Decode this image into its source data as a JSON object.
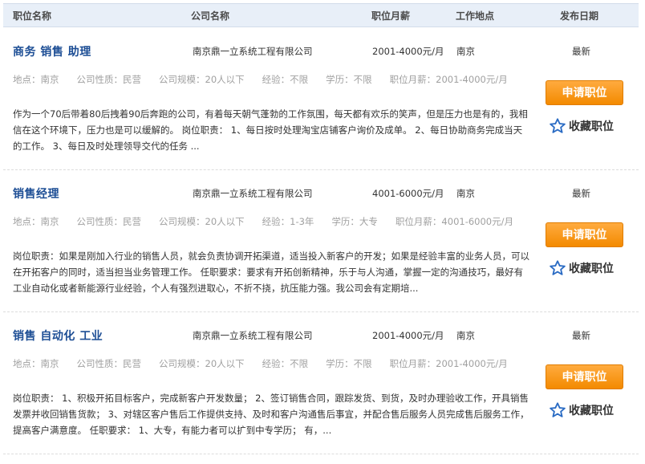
{
  "header": {
    "title": "职位名称",
    "company": "公司名称",
    "salary": "职位月薪",
    "location": "工作地点",
    "date": "发布日期"
  },
  "actions": {
    "apply_label": "申请职位",
    "favorite_label": "收藏职位"
  },
  "jobs": [
    {
      "title": "商务 销售 助理",
      "company": "南京鼎一立系统工程有限公司",
      "salary": "2001-4000元/月",
      "location": "南京",
      "date": "最新",
      "meta": {
        "place": "地点：南京",
        "nature": "公司性质：民营",
        "scale": "公司规模：20人以下",
        "experience": "经验：不限",
        "education": "学历：不限",
        "salary": "职位月薪：2001-4000元/月"
      },
      "description": "作为一个70后带着80后拽着90后奔跑的公司，有着每天朝气蓬勃的工作氛围，每天都有欢乐的笑声，但是压力也是有的，我相信在这个环境下，压力也是可以缓解的。 岗位职责： 1、每日按时处理淘宝店铺客户询价及成单。 2、每日协助商务完成当天的工作。 3、每日及时处理领导交代的任务 ..."
    },
    {
      "title": "销售经理",
      "company": "南京鼎一立系统工程有限公司",
      "salary": "4001-6000元/月",
      "location": "南京",
      "date": "最新",
      "meta": {
        "place": "地点：南京",
        "nature": "公司性质：民营",
        "scale": "公司规模：20人以下",
        "experience": "经验：1-3年",
        "education": "学历：大专",
        "salary": "职位月薪：4001-6000元/月"
      },
      "description": "岗位职责：如果是刚加入行业的销售人员，就会负责协调开拓渠道，适当投入新客户的开发；如果是经验丰富的业务人员，可以在开拓客户的同时，适当担当业务管理工作。 任职要求：要求有开拓创新精神，乐于与人沟通，掌握一定的沟通技巧，最好有工业自动化或者新能源行业经验，个人有强烈进取心，不折不挠，抗压能力强。我公司会有定期培..."
    },
    {
      "title": "销售 自动化 工业",
      "company": "南京鼎一立系统工程有限公司",
      "salary": "2001-4000元/月",
      "location": "南京",
      "date": "最新",
      "meta": {
        "place": "地点：南京",
        "nature": "公司性质：民营",
        "scale": "公司规模：20人以下",
        "experience": "经验：不限",
        "education": "学历：不限",
        "salary": "职位月薪：2001-4000元/月"
      },
      "description": "岗位职责： 1、积极开拓目标客户，完成新客户开发数量； 2、签订销售合同，跟踪发货、到货，及时办理验收工作，开具销售发票并收回销售货款； 3、对辖区客户售后工作提供支持、及时和客户沟通售后事宜，并配合售后服务人员完成售后服务工作，提高客户满意度。 任职要求： 1、大专，有能力者可以扩到中专学历； 有，..."
    }
  ]
}
